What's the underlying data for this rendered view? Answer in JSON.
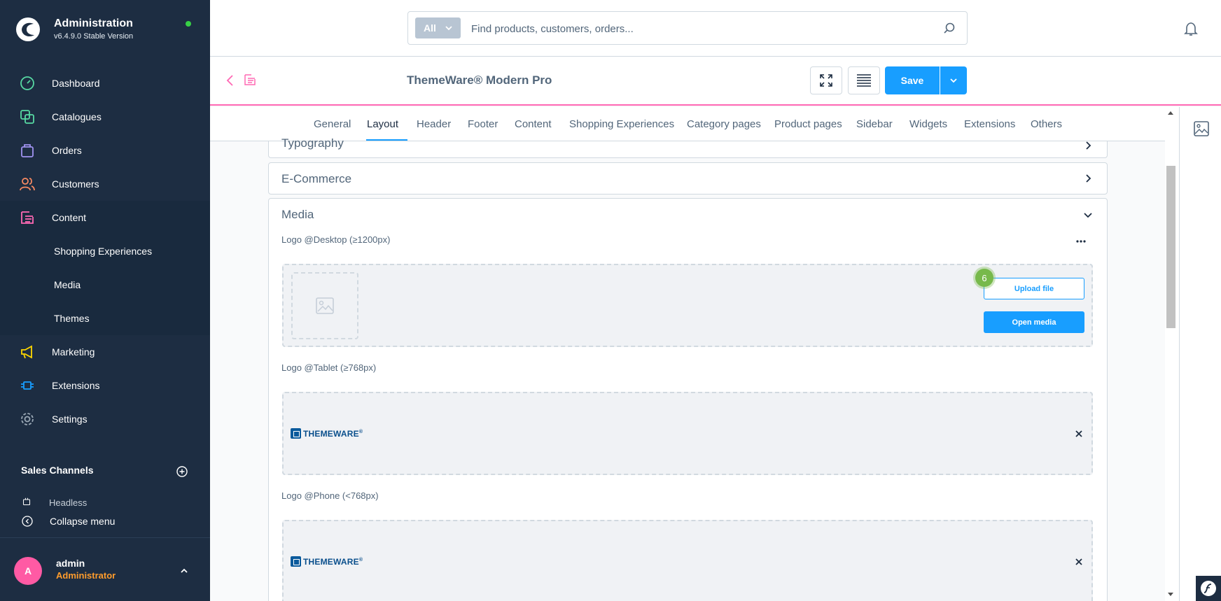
{
  "app": {
    "title": "Administration",
    "version": "v6.4.9.0 Stable Version",
    "status_color": "#37d046"
  },
  "nav": {
    "items": [
      {
        "label": "Dashboard",
        "icon": "dashboard-icon",
        "color": "#57d9a3"
      },
      {
        "label": "Catalogues",
        "icon": "catalogues-icon",
        "color": "#57d9a3"
      },
      {
        "label": "Orders",
        "icon": "orders-icon",
        "color": "#a092f0"
      },
      {
        "label": "Customers",
        "icon": "customers-icon",
        "color": "#f88962"
      },
      {
        "label": "Content",
        "icon": "content-icon",
        "color": "#ff68b4"
      },
      {
        "label": "Marketing",
        "icon": "marketing-icon",
        "color": "#ffd700"
      },
      {
        "label": "Extensions",
        "icon": "extensions-icon",
        "color": "#189eff"
      },
      {
        "label": "Settings",
        "icon": "settings-icon",
        "color": "#9aa8b5"
      }
    ],
    "content_children": [
      {
        "label": "Shopping Experiences"
      },
      {
        "label": "Media"
      },
      {
        "label": "Themes"
      }
    ],
    "sales_channels_title": "Sales Channels",
    "sales_channel_first": "Headless",
    "collapse_label": "Collapse menu"
  },
  "user": {
    "initial": "A",
    "name": "admin",
    "role": "Administrator"
  },
  "search": {
    "filter_label": "All",
    "placeholder": "Find products, customers, orders..."
  },
  "smartbar": {
    "title": "ThemeWare® Modern Pro",
    "save_label": "Save"
  },
  "tabs": [
    {
      "label": "General",
      "active": false
    },
    {
      "label": "Layout",
      "active": true
    },
    {
      "label": "Header",
      "active": false
    },
    {
      "label": "Footer",
      "active": false
    },
    {
      "label": "Content",
      "active": false
    },
    {
      "label": "Shopping Experiences",
      "active": false
    },
    {
      "label": "Category pages",
      "active": false
    },
    {
      "label": "Product pages",
      "active": false
    },
    {
      "label": "Sidebar",
      "active": false
    },
    {
      "label": "Widgets",
      "active": false
    },
    {
      "label": "Extensions",
      "active": false
    },
    {
      "label": "Others",
      "active": false
    }
  ],
  "cards": {
    "typography": "Typography",
    "ecommerce": "E-Commerce",
    "media": "Media"
  },
  "media": {
    "logo_desktop_label": "Logo @Desktop (≥1200px)",
    "logo_tablet_label": "Logo @Tablet (≥768px)",
    "logo_phone_label": "Logo @Phone (<768px)",
    "upload_label": "Upload file",
    "open_media_label": "Open media",
    "badge": "6",
    "logo_text": "THEMEWARE",
    "logo_mark": "®"
  },
  "colors": {
    "primary": "#189eff",
    "sidebar": "#1d2d42",
    "accent_pink": "#ff68b4",
    "role": "#ff9c2c"
  }
}
